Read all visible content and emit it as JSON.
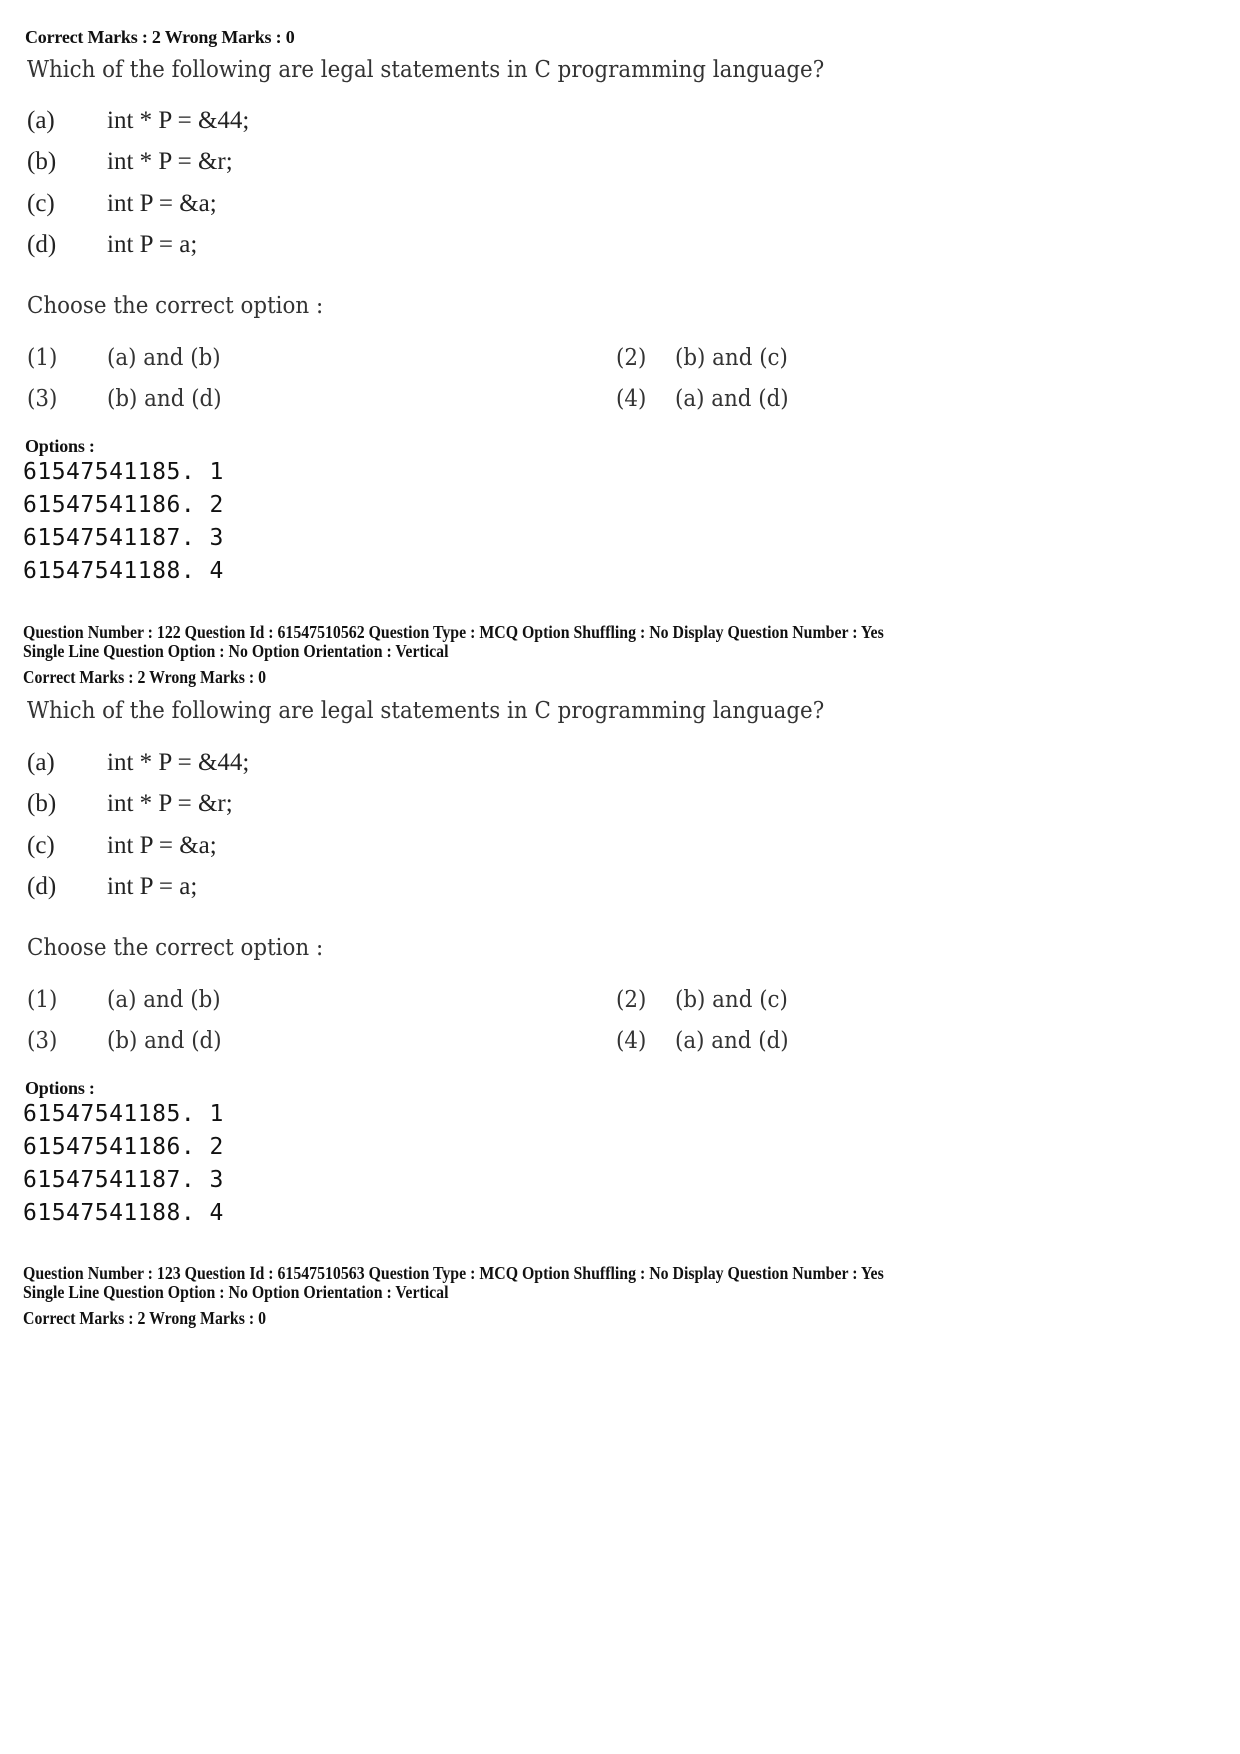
{
  "blocks": [
    {
      "marks": "Correct Marks : 2  Wrong Marks : 0",
      "question": "Which of the following are legal statements in C programming language?",
      "statements": [
        {
          "label": "(a)",
          "text": "int * P = &44;"
        },
        {
          "label": "(b)",
          "text": "int * P = &r;"
        },
        {
          "label": "(c)",
          "text": "int P = &a;"
        },
        {
          "label": "(d)",
          "text": "int P = a;"
        }
      ],
      "choose": "Choose the correct option :",
      "choices": [
        {
          "label": "(1)",
          "text": "(a) and (b)"
        },
        {
          "label": "(2)",
          "text": "(b) and (c)"
        },
        {
          "label": "(3)",
          "text": "(b) and (d)"
        },
        {
          "label": "(4)",
          "text": "(a) and (d)"
        }
      ],
      "options_heading": "Options :",
      "options": [
        "61547541185. 1",
        "61547541186. 2",
        "61547541187. 3",
        "61547541188. 4"
      ]
    },
    {
      "header_line1": "Question Number : 122  Question Id : 61547510562  Question Type : MCQ  Option Shuffling : No  Display Question Number : Yes",
      "header_line2": "Single Line Question Option : No  Option Orientation : Vertical",
      "marks": "Correct Marks : 2  Wrong Marks : 0",
      "question": "Which of the following are legal statements in C programming language?",
      "statements": [
        {
          "label": "(a)",
          "text": "int * P = &44;"
        },
        {
          "label": "(b)",
          "text": "int * P = &r;"
        },
        {
          "label": "(c)",
          "text": "int P = &a;"
        },
        {
          "label": "(d)",
          "text": "int P = a;"
        }
      ],
      "choose": "Choose the correct option :",
      "choices": [
        {
          "label": "(1)",
          "text": "(a) and (b)"
        },
        {
          "label": "(2)",
          "text": "(b) and (c)"
        },
        {
          "label": "(3)",
          "text": "(b) and (d)"
        },
        {
          "label": "(4)",
          "text": "(a) and (d)"
        }
      ],
      "options_heading": "Options :",
      "options": [
        "61547541185. 1",
        "61547541186. 2",
        "61547541187. 3",
        "61547541188. 4"
      ]
    },
    {
      "header_line1": "Question Number : 123  Question Id : 61547510563  Question Type : MCQ  Option Shuffling : No  Display Question Number : Yes",
      "header_line2": "Single Line Question Option : No  Option Orientation : Vertical",
      "marks": "Correct Marks : 2  Wrong Marks : 0"
    }
  ]
}
